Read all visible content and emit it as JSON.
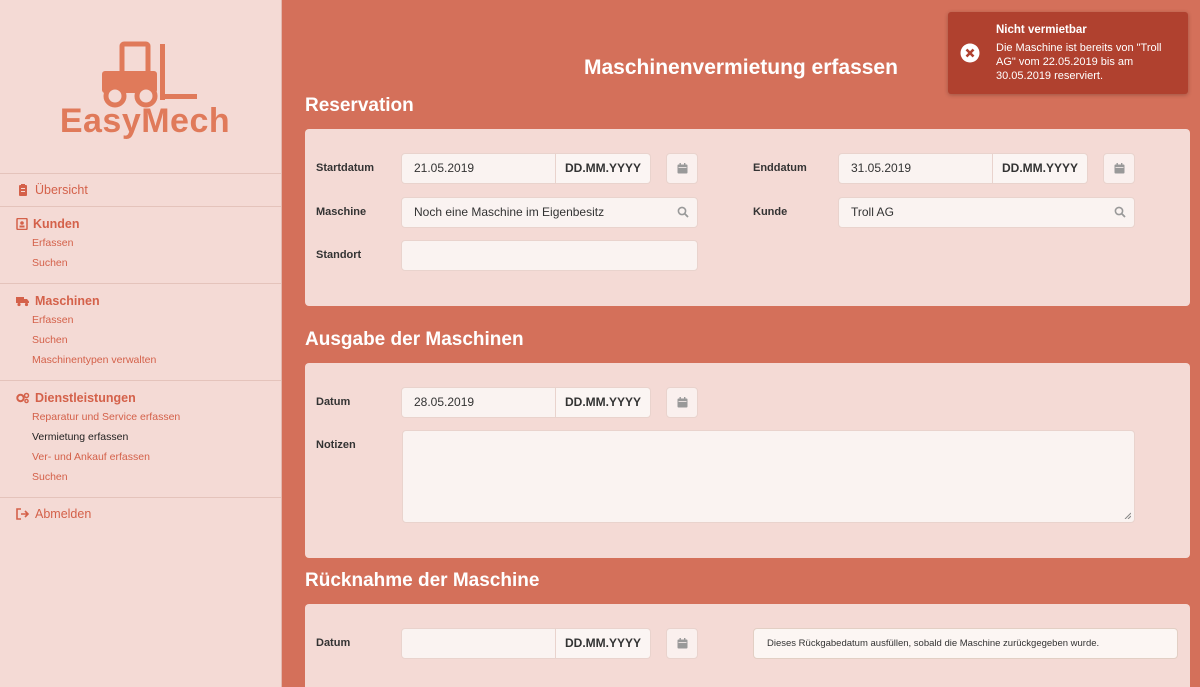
{
  "app": {
    "brand": "EasyMech",
    "page_title": "Maschinenvermietung erfassen"
  },
  "sidebar": {
    "overview": "Übersicht",
    "groups": [
      {
        "title": "Kunden",
        "items": [
          "Erfassen",
          "Suchen"
        ]
      },
      {
        "title": "Maschinen",
        "items": [
          "Erfassen",
          "Suchen",
          "Maschinentypen verwalten"
        ]
      },
      {
        "title": "Dienstleistungen",
        "items": [
          "Reparatur und Service erfassen",
          "Vermietung erfassen",
          "Ver- und Ankauf erfassen",
          "Suchen"
        ],
        "active_item": "Vermietung erfassen"
      }
    ],
    "logout": "Abmelden"
  },
  "reservation": {
    "title": "Reservation",
    "start_label": "Startdatum",
    "start_value": "21.05.2019",
    "end_label": "Enddatum",
    "end_value": "31.05.2019",
    "date_format": "DD.MM.YYYY",
    "machine_label": "Maschine",
    "machine_value": "Noch eine Maschine im Eigenbesitz",
    "customer_label": "Kunde",
    "customer_value": "Troll AG",
    "location_label": "Standort",
    "location_value": ""
  },
  "issue": {
    "title": "Ausgabe der Maschinen",
    "date_label": "Datum",
    "date_value": "28.05.2019",
    "date_format": "DD.MM.YYYY",
    "notes_label": "Notizen"
  },
  "return": {
    "title": "Rücknahme der Maschine",
    "date_label": "Datum",
    "date_value": "",
    "date_format": "DD.MM.YYYY",
    "hint": "Dieses Rückgabedatum ausfüllen, sobald die Maschine zurückgegeben wurde."
  },
  "toast": {
    "title": "Nicht vermietbar",
    "message": "Die Maschine ist bereits von \"Troll AG\" vom 22.05.2019 bis am 30.05.2019 reserviert."
  },
  "colors": {
    "background": "#d4705a",
    "sidebar": "#f4dad5",
    "accent": "#e07a5a",
    "toast": "#b0412f"
  }
}
